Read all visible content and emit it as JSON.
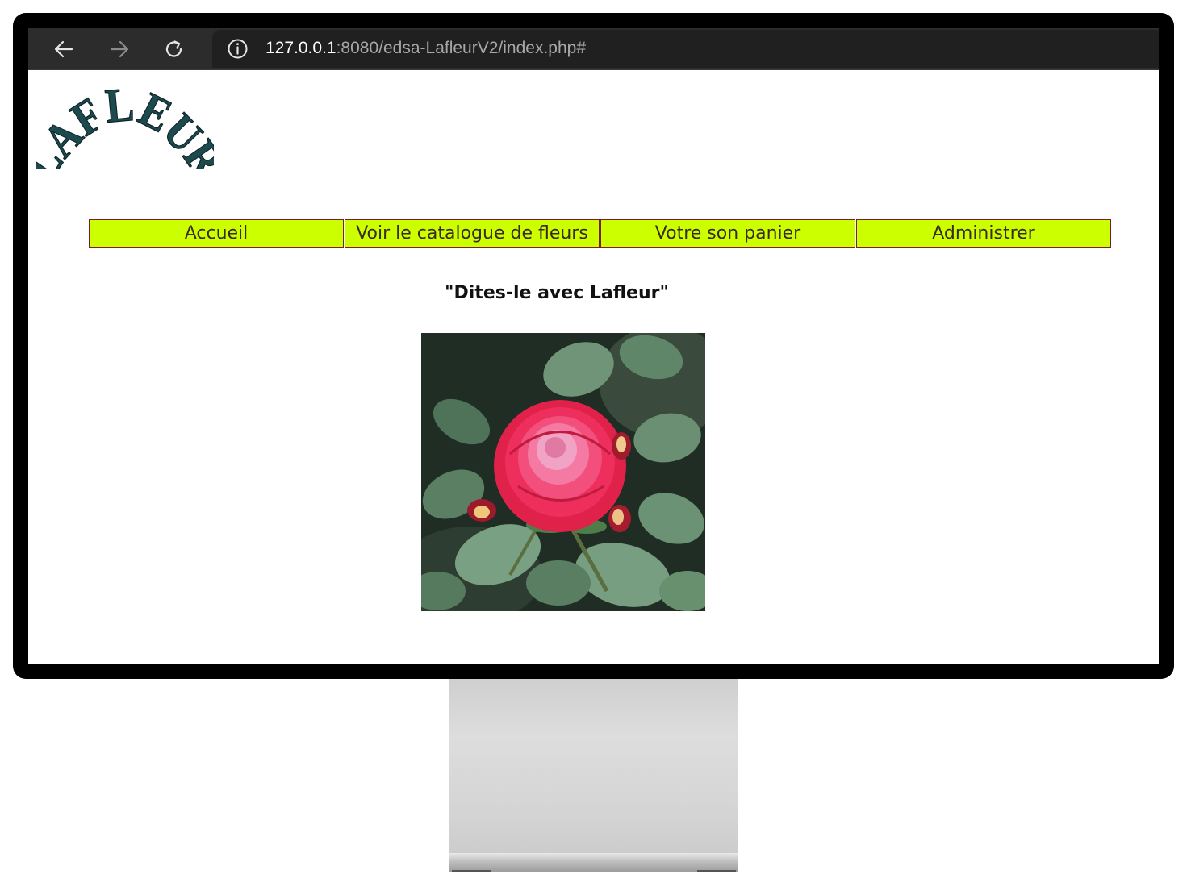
{
  "browser": {
    "url_host": "127.0.0.1",
    "url_path": ":8080/edsa-LafleurV2/index.php#",
    "icons": {
      "back": "arrow-left-icon",
      "forward": "arrow-right-icon",
      "reload": "reload-icon",
      "info": "info-icon"
    }
  },
  "site": {
    "logo_text": "LAFLEUR",
    "slogan": "\"Dites-le avec Lafleur\"",
    "menu": [
      {
        "label": "Accueil"
      },
      {
        "label": "Voir le catalogue de fleurs"
      },
      {
        "label": "Votre son panier"
      },
      {
        "label": "Administrer"
      }
    ],
    "colors": {
      "menu_bg": "#ccff00",
      "menu_border": "#7a1f1f",
      "logo": "#1d4a4f"
    }
  }
}
